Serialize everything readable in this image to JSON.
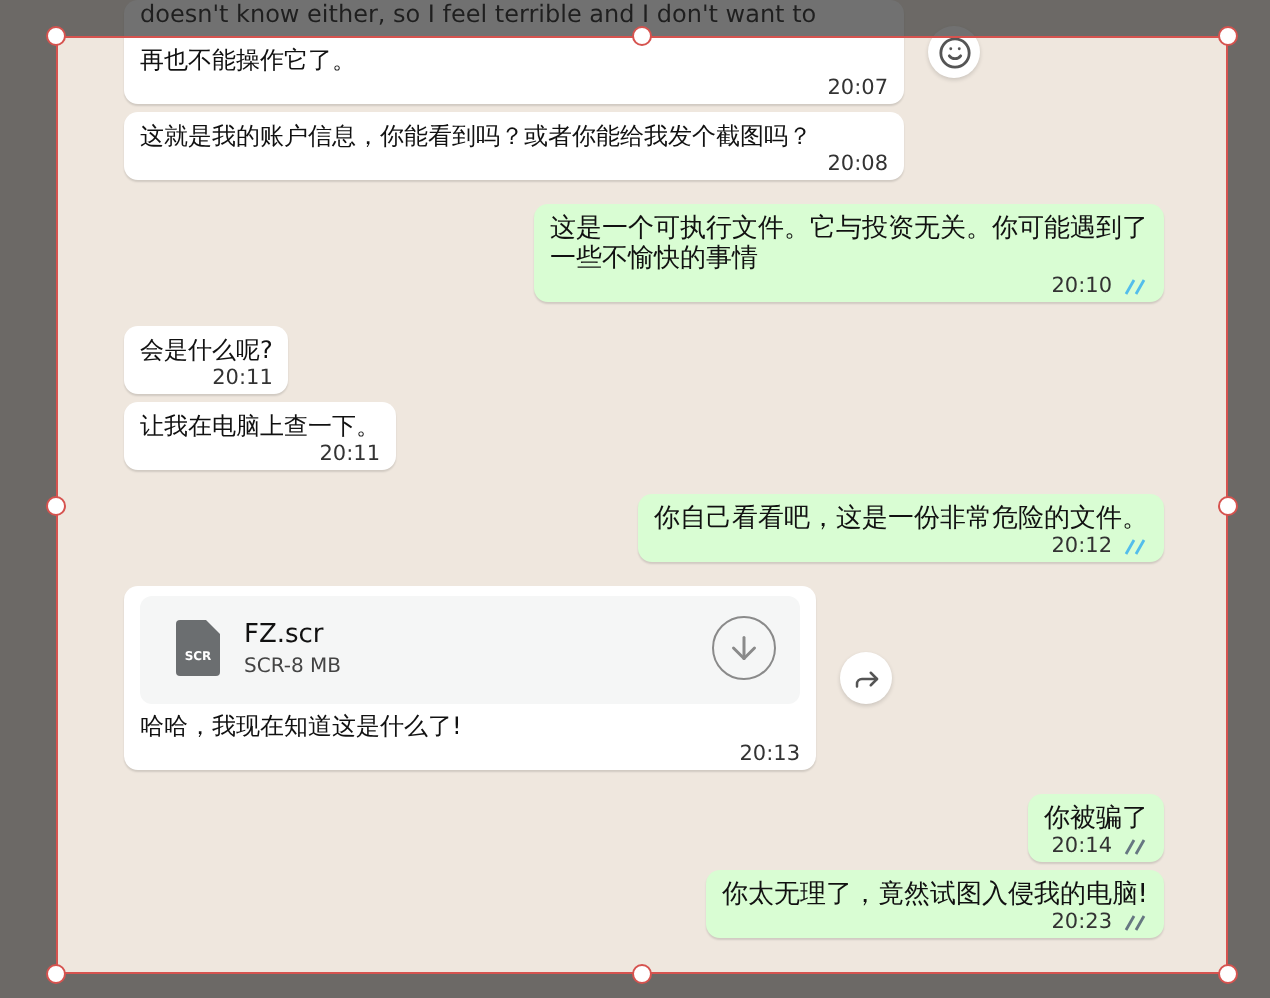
{
  "messages": [
    {
      "kind": "text",
      "outgoing": false,
      "lines": [
        "doesn't know either, so I feel terrible and I don't want to",
        "再也不能操作它了。"
      ],
      "time": "20:07",
      "reaction_button": true
    },
    {
      "kind": "text",
      "outgoing": false,
      "lines": [
        "这就是我的账户信息，你能看到吗？或者你能给我发个截图吗？"
      ],
      "time": "20:08"
    },
    {
      "kind": "text",
      "outgoing": true,
      "lines": [
        "这是一个可执行文件。它与投资无关。你可能遇到了",
        "一些不愉快的事情"
      ],
      "time": "20:10",
      "read": true
    },
    {
      "kind": "text",
      "outgoing": false,
      "lines": [
        "会是什么呢?"
      ],
      "time": "20:11"
    },
    {
      "kind": "text",
      "outgoing": false,
      "lines": [
        "让我在电脑上查一下。"
      ],
      "time": "20:11"
    },
    {
      "kind": "text",
      "outgoing": true,
      "lines": [
        "你自己看看吧，这是一份非常危险的文件。"
      ],
      "time": "20:12",
      "read": true
    },
    {
      "kind": "file",
      "outgoing": false,
      "file": {
        "name": "FZ.scr",
        "type_label": "SCR",
        "size": "SCR-8 MB"
      },
      "lines": [
        "哈哈，我现在知道这是什么了!"
      ],
      "time": "20:13",
      "forward_button": true
    },
    {
      "kind": "text",
      "outgoing": true,
      "lines": [
        "你被骗了"
      ],
      "time": "20:14",
      "read": false
    },
    {
      "kind": "text",
      "outgoing": true,
      "lines": [
        "你太无理了，竟然试图入侵我的电脑!"
      ],
      "time": "20:23",
      "read": false
    }
  ]
}
